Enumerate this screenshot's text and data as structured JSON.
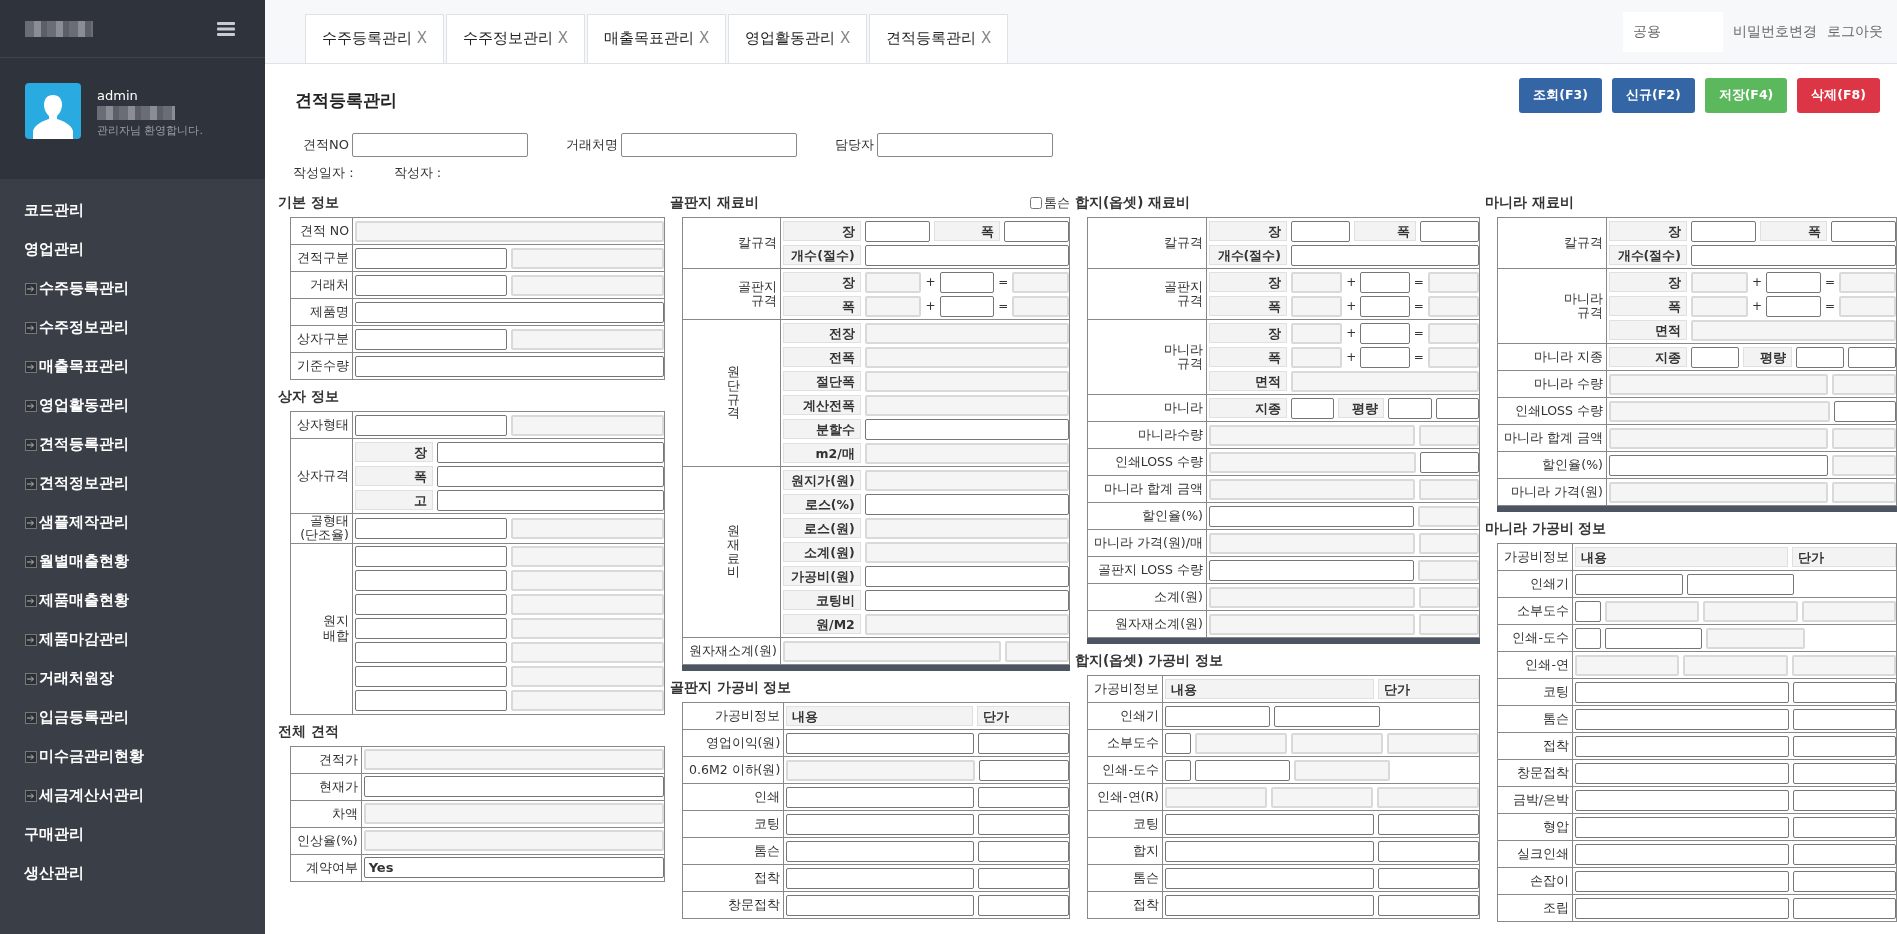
{
  "sidebar": {
    "user": {
      "name": "admin",
      "greeting": "관리자님 환영합니다."
    },
    "menu": [
      {
        "label": "코드관리"
      },
      {
        "label": "영업관리",
        "expanded": true,
        "children": [
          {
            "label": "수주등록관리"
          },
          {
            "label": "수주정보관리"
          },
          {
            "label": "매출목표관리"
          },
          {
            "label": "영업활동관리"
          },
          {
            "label": "견적등록관리"
          },
          {
            "label": "견적정보관리"
          },
          {
            "label": "샘플제작관리"
          },
          {
            "label": "월별매출현황"
          },
          {
            "label": "제품매출현황"
          },
          {
            "label": "제품마감관리"
          },
          {
            "label": "거래처원장"
          },
          {
            "label": "입금등록관리"
          },
          {
            "label": "미수금관리현황"
          },
          {
            "label": "세금계산서관리"
          }
        ]
      },
      {
        "label": "구매관리"
      },
      {
        "label": "생산관리"
      }
    ]
  },
  "tabs": [
    {
      "label": "수주등록관리",
      "close": "X"
    },
    {
      "label": "수주정보관리",
      "close": "X"
    },
    {
      "label": "매출목표관리",
      "close": "X"
    },
    {
      "label": "영업활동관리",
      "close": "X"
    },
    {
      "label": "견적등록관리",
      "close": "X"
    }
  ],
  "top_right": {
    "scope_field": "공용",
    "links": [
      "비밀번호변경",
      "로그아웃"
    ]
  },
  "page_title": "견적등록관리",
  "buttons": [
    {
      "label": "조회(F3)",
      "color": "#3465a4"
    },
    {
      "label": "신규(F2)",
      "color": "#3465a4"
    },
    {
      "label": "저장(F4)",
      "color": "#5cb85c"
    },
    {
      "label": "삭제(F8)",
      "color": "#dc3545"
    }
  ],
  "search_fields": [
    {
      "label": "견적NO"
    },
    {
      "label": "거래처명"
    },
    {
      "label": "담당자"
    }
  ],
  "meta": [
    "작성일자 :",
    "작성자 :"
  ],
  "columns": [
    [
      {
        "title": "기본 정보",
        "kind": "basic",
        "groups": [
          {
            "label": "견적 NO",
            "rows": [
              [
                {
                  "kind": "field",
                  "readonly": true
                }
              ]
            ]
          },
          {
            "label": "견적구분",
            "rows": [
              [
                {
                  "kind": "field",
                  "readonly": false
                },
                {
                  "kind": "field",
                  "readonly": true
                }
              ]
            ]
          },
          {
            "label": "거래처",
            "rows": [
              [
                {
                  "kind": "field",
                  "readonly": false
                },
                {
                  "kind": "field",
                  "readonly": true
                }
              ]
            ]
          },
          {
            "label": "제품명",
            "rows": [
              [
                {
                  "kind": "field",
                  "readonly": false
                }
              ]
            ]
          },
          {
            "label": "상자구분",
            "rows": [
              [
                {
                  "kind": "field",
                  "readonly": false
                },
                {
                  "kind": "field",
                  "readonly": true
                }
              ]
            ]
          },
          {
            "label": "기준수량",
            "rows": [
              [
                {
                  "kind": "field",
                  "readonly": false
                }
              ]
            ]
          }
        ]
      },
      {
        "title": "상자 정보",
        "kind": "basic",
        "groups": [
          {
            "label": "상자형태",
            "rows": [
              [
                {
                  "kind": "field",
                  "readonly": false
                },
                {
                  "kind": "field",
                  "readonly": true
                }
              ]
            ]
          },
          {
            "label": "상자규격",
            "rows": [
              [
                {
                  "kind": "tag",
                  "text": "장"
                },
                {
                  "kind": "field",
                  "readonly": false
                }
              ],
              [
                {
                  "kind": "tag",
                  "text": "폭"
                },
                {
                  "kind": "field",
                  "readonly": false
                }
              ],
              [
                {
                  "kind": "tag",
                  "text": "고"
                },
                {
                  "kind": "field",
                  "readonly": false
                }
              ]
            ]
          },
          {
            "label": "골형태\n(단조율)",
            "rows": [
              [
                {
                  "kind": "field",
                  "readonly": false
                },
                {
                  "kind": "field",
                  "readonly": true
                }
              ]
            ]
          },
          {
            "label": "원지\n배합",
            "rows": [
              [
                {
                  "kind": "field",
                  "readonly": false
                },
                {
                  "kind": "field",
                  "readonly": true
                }
              ],
              [
                {
                  "kind": "field",
                  "readonly": false
                },
                {
                  "kind": "field",
                  "readonly": true
                }
              ],
              [
                {
                  "kind": "field",
                  "readonly": false
                },
                {
                  "kind": "field",
                  "readonly": true
                }
              ],
              [
                {
                  "kind": "field",
                  "readonly": false
                },
                {
                  "kind": "field",
                  "readonly": true
                }
              ],
              [
                {
                  "kind": "field",
                  "readonly": false
                },
                {
                  "kind": "field",
                  "readonly": true
                }
              ],
              [
                {
                  "kind": "field",
                  "readonly": false
                },
                {
                  "kind": "field",
                  "readonly": true
                }
              ],
              [
                {
                  "kind": "field",
                  "readonly": false
                },
                {
                  "kind": "field",
                  "readonly": true
                }
              ]
            ]
          }
        ]
      },
      {
        "title": "전체 견적",
        "kind": "basic",
        "groups": [
          {
            "label": "견적가",
            "rows": [
              [
                {
                  "kind": "field",
                  "readonly": true
                }
              ]
            ]
          },
          {
            "label": "현재가",
            "rows": [
              [
                {
                  "kind": "field",
                  "readonly": false
                }
              ]
            ]
          },
          {
            "label": "차액",
            "rows": [
              [
                {
                  "kind": "field",
                  "readonly": true
                }
              ]
            ]
          },
          {
            "label": "인상율(%)",
            "rows": [
              [
                {
                  "kind": "field",
                  "readonly": true
                }
              ]
            ]
          },
          {
            "label": "계약여부",
            "rows": [
              [
                {
                  "kind": "value",
                  "text": "Yes"
                }
              ]
            ]
          }
        ]
      }
    ],
    [
      {
        "title": "골판지 재료비",
        "kind": "material",
        "option": {
          "label": "톰슨",
          "checked": false
        },
        "groups": [
          {
            "label": "칼규격",
            "rows": [
              [
                {
                  "kind": "tag",
                  "text": "장"
                },
                {
                  "kind": "field",
                  "readonly": false
                },
                {
                  "kind": "tag",
                  "text": "폭"
                },
                {
                  "kind": "field",
                  "readonly": false
                }
              ],
              [
                {
                  "kind": "tag",
                  "text": "개수(절수)"
                },
                {
                  "kind": "field",
                  "readonly": false
                }
              ]
            ]
          },
          {
            "label": "골판지\n규격",
            "rows": [
              [
                {
                  "kind": "tag",
                  "text": "장"
                },
                {
                  "kind": "field",
                  "readonly": true
                },
                {
                  "kind": "op",
                  "text": "+"
                },
                {
                  "kind": "field",
                  "readonly": false
                },
                {
                  "kind": "op",
                  "text": "="
                },
                {
                  "kind": "field",
                  "readonly": true
                }
              ],
              [
                {
                  "kind": "tag",
                  "text": "폭"
                },
                {
                  "kind": "field",
                  "readonly": true
                },
                {
                  "kind": "op",
                  "text": "+"
                },
                {
                  "kind": "field",
                  "readonly": false
                },
                {
                  "kind": "op",
                  "text": "="
                },
                {
                  "kind": "field",
                  "readonly": true
                }
              ]
            ]
          },
          {
            "label": "원단규격",
            "kind": "vertical",
            "rows": [
              [
                {
                  "kind": "tag",
                  "text": "전장"
                },
                {
                  "kind": "field",
                  "readonly": true
                }
              ],
              [
                {
                  "kind": "tag",
                  "text": "전폭"
                },
                {
                  "kind": "field",
                  "readonly": true
                }
              ],
              [
                {
                  "kind": "tag",
                  "text": "절단폭"
                },
                {
                  "kind": "field",
                  "readonly": true
                }
              ],
              [
                {
                  "kind": "tag",
                  "text": "계산전폭"
                },
                {
                  "kind": "field",
                  "readonly": true
                }
              ],
              [
                {
                  "kind": "tag",
                  "text": "분할수"
                },
                {
                  "kind": "field",
                  "readonly": false
                }
              ],
              [
                {
                  "kind": "tag",
                  "text": "m2/매"
                },
                {
                  "kind": "field",
                  "readonly": true
                }
              ]
            ]
          },
          {
            "label": "원재료비",
            "kind": "vertical",
            "rows": [
              [
                {
                  "kind": "tag",
                  "text": "원지가(원)"
                },
                {
                  "kind": "field",
                  "readonly": true
                }
              ],
              [
                {
                  "kind": "tag",
                  "text": "로스(%)"
                },
                {
                  "kind": "field",
                  "readonly": false
                }
              ],
              [
                {
                  "kind": "tag",
                  "text": "로스(원)"
                },
                {
                  "kind": "field",
                  "readonly": true
                }
              ],
              [
                {
                  "kind": "tag",
                  "text": "소계(원)"
                },
                {
                  "kind": "field",
                  "readonly": true
                }
              ],
              [
                {
                  "kind": "tag",
                  "text": "가공비(원)"
                },
                {
                  "kind": "field",
                  "readonly": false
                }
              ],
              [
                {
                  "kind": "tag",
                  "text": "코팅비"
                },
                {
                  "kind": "field",
                  "readonly": false
                }
              ],
              [
                {
                  "kind": "tag",
                  "text": "원/M2"
                },
                {
                  "kind": "field",
                  "readonly": true
                }
              ]
            ]
          },
          {
            "label": "원자재소계(원)",
            "rows": [
              [
                {
                  "kind": "field",
                  "readonly": true
                },
                {
                  "kind": "field",
                  "readonly": true
                }
              ]
            ]
          }
        ]
      },
      {
        "title": "골판지 가공비 정보",
        "kind": "process",
        "groups": [
          {
            "label": "가공비정보",
            "rows": [
              [
                {
                  "kind": "tag",
                  "text": "내용"
                },
                {
                  "kind": "tag",
                  "text": "단가"
                }
              ]
            ]
          },
          {
            "label": "영업이익(원)",
            "rows": [
              [
                {
                  "kind": "field",
                  "readonly": false
                },
                {
                  "kind": "field",
                  "readonly": false
                }
              ]
            ]
          },
          {
            "label": "0.6M2 이하(원)",
            "rows": [
              [
                {
                  "kind": "field",
                  "readonly": true
                },
                {
                  "kind": "field",
                  "readonly": false
                }
              ]
            ]
          },
          {
            "label": "인쇄",
            "rows": [
              [
                {
                  "kind": "field",
                  "readonly": false
                },
                {
                  "kind": "field",
                  "readonly": false
                }
              ]
            ]
          },
          {
            "label": "코팅",
            "rows": [
              [
                {
                  "kind": "field",
                  "readonly": false
                },
                {
                  "kind": "field",
                  "readonly": false
                }
              ]
            ]
          },
          {
            "label": "톰슨",
            "rows": [
              [
                {
                  "kind": "field",
                  "readonly": false
                },
                {
                  "kind": "field",
                  "readonly": false
                }
              ]
            ]
          },
          {
            "label": "접착",
            "rows": [
              [
                {
                  "kind": "field",
                  "readonly": false
                },
                {
                  "kind": "field",
                  "readonly": false
                }
              ]
            ]
          },
          {
            "label": "창문접착",
            "rows": [
              [
                {
                  "kind": "field",
                  "readonly": false
                },
                {
                  "kind": "field",
                  "readonly": false
                }
              ]
            ]
          }
        ]
      }
    ],
    [
      {
        "title": "합지(옵셋) 재료비",
        "kind": "material",
        "groups": [
          {
            "label": "칼규격",
            "rows": [
              [
                {
                  "kind": "tag",
                  "text": "장"
                },
                {
                  "kind": "field",
                  "readonly": false
                },
                {
                  "kind": "tag",
                  "text": "폭"
                },
                {
                  "kind": "field",
                  "readonly": false
                }
              ],
              [
                {
                  "kind": "tag",
                  "text": "개수(절수)"
                },
                {
                  "kind": "field",
                  "readonly": false
                }
              ]
            ]
          },
          {
            "label": "골판지\n규격",
            "rows": [
              [
                {
                  "kind": "tag",
                  "text": "장"
                },
                {
                  "kind": "field",
                  "readonly": true
                },
                {
                  "kind": "op",
                  "text": "+"
                },
                {
                  "kind": "field",
                  "readonly": false
                },
                {
                  "kind": "op",
                  "text": "="
                },
                {
                  "kind": "field",
                  "readonly": true
                }
              ],
              [
                {
                  "kind": "tag",
                  "text": "폭"
                },
                {
                  "kind": "field",
                  "readonly": true
                },
                {
                  "kind": "op",
                  "text": "+"
                },
                {
                  "kind": "field",
                  "readonly": false
                },
                {
                  "kind": "op",
                  "text": "="
                },
                {
                  "kind": "field",
                  "readonly": true
                }
              ]
            ]
          },
          {
            "label": "마니라\n규격",
            "rows": [
              [
                {
                  "kind": "tag",
                  "text": "장"
                },
                {
                  "kind": "field",
                  "readonly": true
                },
                {
                  "kind": "op",
                  "text": "+"
                },
                {
                  "kind": "field",
                  "readonly": false
                },
                {
                  "kind": "op",
                  "text": "="
                },
                {
                  "kind": "field",
                  "readonly": true
                }
              ],
              [
                {
                  "kind": "tag",
                  "text": "폭"
                },
                {
                  "kind": "field",
                  "readonly": true
                },
                {
                  "kind": "op",
                  "text": "+"
                },
                {
                  "kind": "field",
                  "readonly": false
                },
                {
                  "kind": "op",
                  "text": "="
                },
                {
                  "kind": "field",
                  "readonly": true
                }
              ],
              [
                {
                  "kind": "tag",
                  "text": "면적"
                },
                {
                  "kind": "field",
                  "readonly": true
                }
              ]
            ]
          },
          {
            "label": "마니라",
            "rows": [
              [
                {
                  "kind": "tag",
                  "text": "지종"
                },
                {
                  "kind": "field",
                  "readonly": false
                },
                {
                  "kind": "tag",
                  "text": "평량"
                },
                {
                  "kind": "field",
                  "readonly": false
                },
                {
                  "kind": "field",
                  "readonly": false
                }
              ]
            ]
          },
          {
            "label": "마니라수량",
            "rows": [
              [
                {
                  "kind": "field",
                  "readonly": true
                },
                {
                  "kind": "field",
                  "readonly": true
                }
              ]
            ]
          },
          {
            "label": "인쇄LOSS 수량",
            "rows": [
              [
                {
                  "kind": "field",
                  "readonly": true
                },
                {
                  "kind": "field",
                  "readonly": false
                }
              ]
            ]
          },
          {
            "label": "마니라 합계 금액",
            "rows": [
              [
                {
                  "kind": "field",
                  "readonly": true
                },
                {
                  "kind": "field",
                  "readonly": true
                }
              ]
            ]
          },
          {
            "label": "할인율(%)",
            "rows": [
              [
                {
                  "kind": "field",
                  "readonly": false
                },
                {
                  "kind": "field",
                  "readonly": true
                }
              ]
            ]
          },
          {
            "label": "마니라 가격(원)/매",
            "rows": [
              [
                {
                  "kind": "field",
                  "readonly": true
                },
                {
                  "kind": "field",
                  "readonly": true
                }
              ]
            ]
          },
          {
            "label": "골판지 LOSS 수량",
            "rows": [
              [
                {
                  "kind": "field",
                  "readonly": false
                },
                {
                  "kind": "field",
                  "readonly": true
                }
              ]
            ]
          },
          {
            "label": "소계(원)",
            "rows": [
              [
                {
                  "kind": "field",
                  "readonly": true
                },
                {
                  "kind": "field",
                  "readonly": true
                }
              ]
            ]
          },
          {
            "label": "원자재소계(원)",
            "rows": [
              [
                {
                  "kind": "field",
                  "readonly": true
                },
                {
                  "kind": "field",
                  "readonly": true
                }
              ]
            ]
          }
        ]
      },
      {
        "title": "합지(옵셋) 가공비 정보",
        "kind": "process",
        "groups": [
          {
            "label": "가공비정보",
            "rows": [
              [
                {
                  "kind": "tag",
                  "text": "내용"
                },
                {
                  "kind": "tag",
                  "text": "단가"
                }
              ]
            ]
          },
          {
            "label": "인쇄기",
            "rows": [
              [
                {
                  "kind": "field",
                  "readonly": false
                },
                {
                  "kind": "field",
                  "readonly": false
                },
                {
                  "kind": "gap"
                }
              ]
            ]
          },
          {
            "label": "소부도수",
            "rows": [
              [
                {
                  "kind": "small"
                },
                {
                  "kind": "field",
                  "readonly": true
                },
                {
                  "kind": "field",
                  "readonly": true
                },
                {
                  "kind": "field",
                  "readonly": true
                }
              ]
            ]
          },
          {
            "label": "인쇄-도수",
            "rows": [
              [
                {
                  "kind": "small"
                },
                {
                  "kind": "field",
                  "readonly": false
                },
                {
                  "kind": "field",
                  "readonly": true
                },
                {
                  "kind": "gap"
                }
              ]
            ]
          },
          {
            "label": "인쇄-연(R)",
            "rows": [
              [
                {
                  "kind": "field",
                  "readonly": true
                },
                {
                  "kind": "field",
                  "readonly": true
                },
                {
                  "kind": "field",
                  "readonly": true
                }
              ]
            ]
          },
          {
            "label": "코팅",
            "rows": [
              [
                {
                  "kind": "field",
                  "readonly": false
                },
                {
                  "kind": "field",
                  "readonly": false
                }
              ]
            ]
          },
          {
            "label": "합지",
            "rows": [
              [
                {
                  "kind": "field",
                  "readonly": false
                },
                {
                  "kind": "field",
                  "readonly": false
                }
              ]
            ]
          },
          {
            "label": "톰슨",
            "rows": [
              [
                {
                  "kind": "field",
                  "readonly": false
                },
                {
                  "kind": "field",
                  "readonly": false
                }
              ]
            ]
          },
          {
            "label": "접착",
            "rows": [
              [
                {
                  "kind": "field",
                  "readonly": false
                },
                {
                  "kind": "field",
                  "readonly": false
                }
              ]
            ]
          }
        ]
      }
    ],
    [
      {
        "title": "마니라 재료비",
        "kind": "material",
        "groups": [
          {
            "label": "칼규격",
            "rows": [
              [
                {
                  "kind": "tag",
                  "text": "장"
                },
                {
                  "kind": "field",
                  "readonly": false
                },
                {
                  "kind": "tag",
                  "text": "폭"
                },
                {
                  "kind": "field",
                  "readonly": false
                }
              ],
              [
                {
                  "kind": "tag",
                  "text": "개수(절수)"
                },
                {
                  "kind": "field",
                  "readonly": false
                }
              ]
            ]
          },
          {
            "label": "마니라\n규격",
            "rows": [
              [
                {
                  "kind": "tag",
                  "text": "장"
                },
                {
                  "kind": "field",
                  "readonly": true
                },
                {
                  "kind": "op",
                  "text": "+"
                },
                {
                  "kind": "field",
                  "readonly": false
                },
                {
                  "kind": "op",
                  "text": "="
                },
                {
                  "kind": "field",
                  "readonly": true
                }
              ],
              [
                {
                  "kind": "tag",
                  "text": "폭"
                },
                {
                  "kind": "field",
                  "readonly": true
                },
                {
                  "kind": "op",
                  "text": "+"
                },
                {
                  "kind": "field",
                  "readonly": false
                },
                {
                  "kind": "op",
                  "text": "="
                },
                {
                  "kind": "field",
                  "readonly": true
                }
              ],
              [
                {
                  "kind": "tag",
                  "text": "면적"
                },
                {
                  "kind": "field",
                  "readonly": true
                }
              ]
            ]
          },
          {
            "label": "마니라 지종",
            "rows": [
              [
                {
                  "kind": "tag",
                  "text": "지종"
                },
                {
                  "kind": "field",
                  "readonly": false
                },
                {
                  "kind": "tag",
                  "text": "평량"
                },
                {
                  "kind": "field",
                  "readonly": false
                },
                {
                  "kind": "field",
                  "readonly": false
                }
              ]
            ]
          },
          {
            "label": "마니라 수량",
            "rows": [
              [
                {
                  "kind": "field",
                  "readonly": true
                },
                {
                  "kind": "field",
                  "readonly": true
                }
              ]
            ]
          },
          {
            "label": "인쇄LOSS 수량",
            "rows": [
              [
                {
                  "kind": "field",
                  "readonly": true
                },
                {
                  "kind": "field",
                  "readonly": false
                }
              ]
            ]
          },
          {
            "label": "마니라 합계 금액",
            "rows": [
              [
                {
                  "kind": "field",
                  "readonly": true
                },
                {
                  "kind": "field",
                  "readonly": true
                }
              ]
            ]
          },
          {
            "label": "할인율(%)",
            "rows": [
              [
                {
                  "kind": "field",
                  "readonly": false
                },
                {
                  "kind": "field",
                  "readonly": true
                }
              ]
            ]
          },
          {
            "label": "마니라 가격(원)",
            "rows": [
              [
                {
                  "kind": "field",
                  "readonly": true
                },
                {
                  "kind": "field",
                  "readonly": true
                }
              ]
            ]
          }
        ]
      },
      {
        "title": "마니라 가공비 정보",
        "kind": "process",
        "groups": [
          {
            "label": "가공비정보",
            "rows": [
              [
                {
                  "kind": "tag",
                  "text": "내용"
                },
                {
                  "kind": "tag",
                  "text": "단가"
                }
              ]
            ]
          },
          {
            "label": "인쇄기",
            "rows": [
              [
                {
                  "kind": "field",
                  "readonly": false
                },
                {
                  "kind": "field",
                  "readonly": false
                },
                {
                  "kind": "gap"
                }
              ]
            ]
          },
          {
            "label": "소부도수",
            "rows": [
              [
                {
                  "kind": "small"
                },
                {
                  "kind": "field",
                  "readonly": true
                },
                {
                  "kind": "field",
                  "readonly": true
                },
                {
                  "kind": "field",
                  "readonly": true
                }
              ]
            ]
          },
          {
            "label": "인쇄-도수",
            "rows": [
              [
                {
                  "kind": "small"
                },
                {
                  "kind": "field",
                  "readonly": false
                },
                {
                  "kind": "field",
                  "readonly": true
                },
                {
                  "kind": "gap"
                }
              ]
            ]
          },
          {
            "label": "인쇄-연",
            "rows": [
              [
                {
                  "kind": "field",
                  "readonly": true
                },
                {
                  "kind": "field",
                  "readonly": true
                },
                {
                  "kind": "field",
                  "readonly": true
                }
              ]
            ]
          },
          {
            "label": "코팅",
            "rows": [
              [
                {
                  "kind": "field",
                  "readonly": false
                },
                {
                  "kind": "field",
                  "readonly": false
                }
              ]
            ]
          },
          {
            "label": "톰슨",
            "rows": [
              [
                {
                  "kind": "field",
                  "readonly": false
                },
                {
                  "kind": "field",
                  "readonly": false
                }
              ]
            ]
          },
          {
            "label": "접착",
            "rows": [
              [
                {
                  "kind": "field",
                  "readonly": false
                },
                {
                  "kind": "field",
                  "readonly": false
                }
              ]
            ]
          },
          {
            "label": "창문접착",
            "rows": [
              [
                {
                  "kind": "field",
                  "readonly": false
                },
                {
                  "kind": "field",
                  "readonly": false
                }
              ]
            ]
          },
          {
            "label": "금박/은박",
            "rows": [
              [
                {
                  "kind": "field",
                  "readonly": false
                },
                {
                  "kind": "field",
                  "readonly": false
                }
              ]
            ]
          },
          {
            "label": "형압",
            "rows": [
              [
                {
                  "kind": "field",
                  "readonly": false
                },
                {
                  "kind": "field",
                  "readonly": false
                }
              ]
            ]
          },
          {
            "label": "실크인쇄",
            "rows": [
              [
                {
                  "kind": "field",
                  "readonly": false
                },
                {
                  "kind": "field",
                  "readonly": false
                }
              ]
            ]
          },
          {
            "label": "손잡이",
            "rows": [
              [
                {
                  "kind": "field",
                  "readonly": false
                },
                {
                  "kind": "field",
                  "readonly": false
                }
              ]
            ]
          },
          {
            "label": "조립",
            "rows": [
              [
                {
                  "kind": "field",
                  "readonly": false
                },
                {
                  "kind": "field",
                  "readonly": false
                }
              ]
            ]
          }
        ]
      }
    ]
  ]
}
